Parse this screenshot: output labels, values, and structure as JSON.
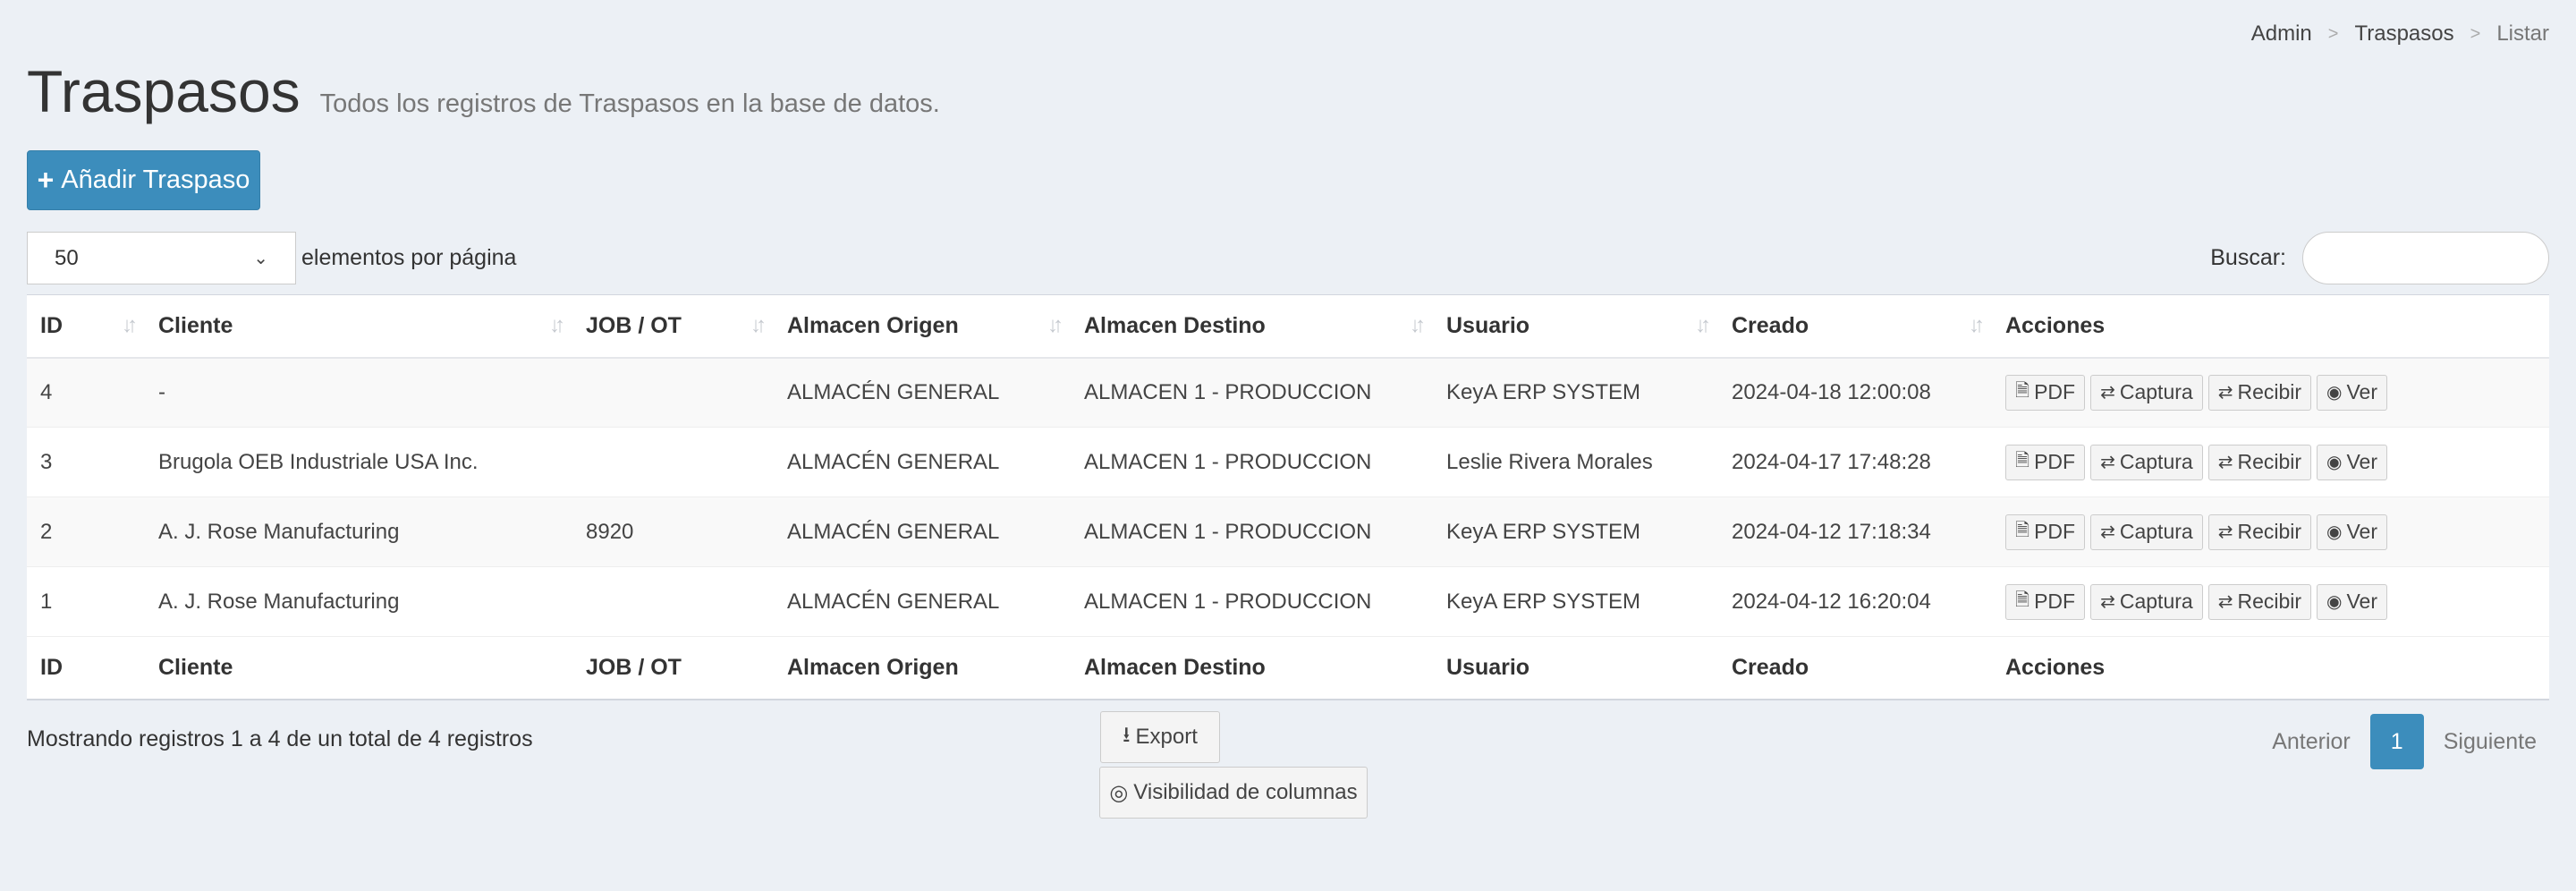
{
  "breadcrumb": {
    "items": [
      "Admin",
      "Traspasos",
      "Listar"
    ]
  },
  "header": {
    "title": "Traspasos",
    "subtitle": "Todos los registros de Traspasos en la base de datos."
  },
  "add_button": {
    "label": "Añadir Traspaso"
  },
  "length": {
    "value": "50",
    "label": "elementos por página"
  },
  "search": {
    "label": "Buscar:",
    "value": ""
  },
  "table": {
    "columns": [
      "ID",
      "Cliente",
      "JOB / OT",
      "Almacen Origen",
      "Almacen Destino",
      "Usuario",
      "Creado",
      "Acciones"
    ],
    "rows": [
      {
        "id": "4",
        "cliente": "-",
        "job": "",
        "origen": "ALMACÉN GENERAL",
        "destino": "ALMACEN 1 - PRODUCCION",
        "usuario": "KeyA ERP SYSTEM",
        "creado": "2024-04-18 12:00:08"
      },
      {
        "id": "3",
        "cliente": "Brugola OEB Industriale USA Inc.",
        "job": "",
        "origen": "ALMACÉN GENERAL",
        "destino": "ALMACEN 1 - PRODUCCION",
        "usuario": "Leslie Rivera Morales",
        "creado": "2024-04-17 17:48:28"
      },
      {
        "id": "2",
        "cliente": "A. J. Rose Manufacturing",
        "job": "8920",
        "origen": "ALMACÉN GENERAL",
        "destino": "ALMACEN 1 - PRODUCCION",
        "usuario": "KeyA ERP SYSTEM",
        "creado": "2024-04-12 17:18:34"
      },
      {
        "id": "1",
        "cliente": "A. J. Rose Manufacturing",
        "job": "",
        "origen": "ALMACÉN GENERAL",
        "destino": "ALMACEN 1 - PRODUCCION",
        "usuario": "KeyA ERP SYSTEM",
        "creado": "2024-04-12 16:20:04"
      }
    ],
    "actions": {
      "pdf": "PDF",
      "captura": "Captura",
      "recibir": "Recibir",
      "ver": "Ver"
    }
  },
  "footer": {
    "info": "Mostrando registros 1 a 4 de un total de 4 registros",
    "export_label": "Export",
    "colvis_label": "Visibilidad de columnas"
  },
  "pagination": {
    "prev": "Anterior",
    "current": "1",
    "next": "Siguiente"
  },
  "colors": {
    "primary": "#3c8dbc",
    "background": "#ecf0f5"
  }
}
